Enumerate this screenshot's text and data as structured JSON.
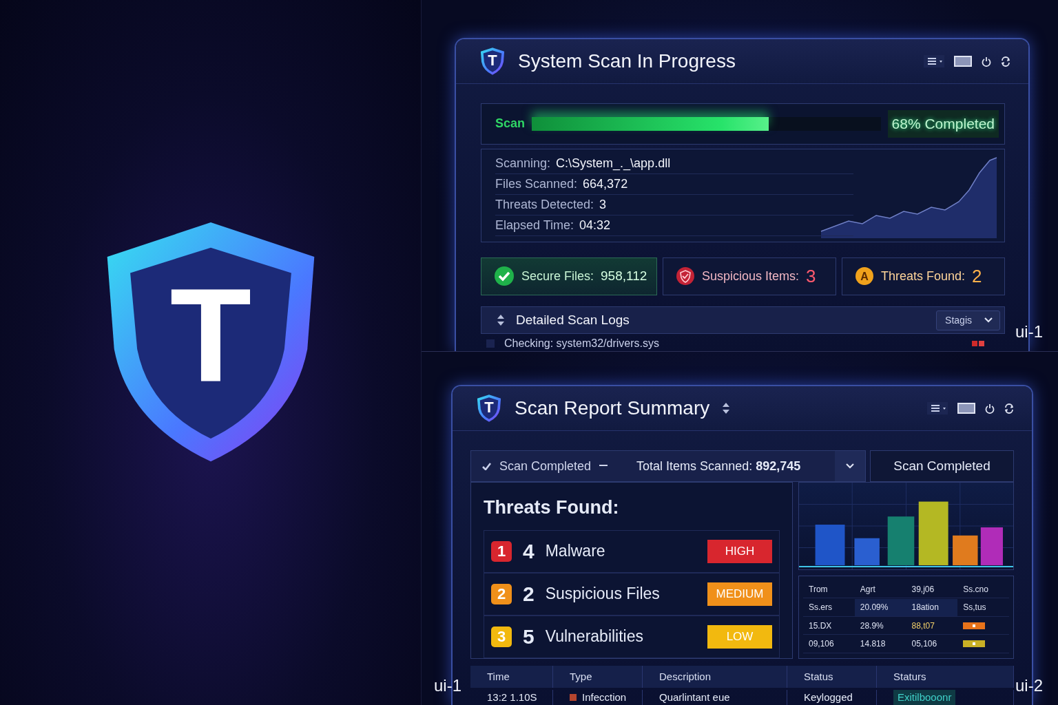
{
  "logo": {
    "letter": "T"
  },
  "panel_labels": [
    "ui-1",
    "ui-1",
    "ui-2"
  ],
  "scan_window": {
    "icon_letter": "T",
    "title": "System Scan In Progress",
    "progress": {
      "label": "Scan",
      "level": 0.68,
      "reading": "68% Completed"
    },
    "details": [
      {
        "label": "Scanning:",
        "value": "C:\\System_._\\app.dll"
      },
      {
        "label": "Files Scanned:",
        "value": "664,372"
      },
      {
        "label": "Threats Detected:",
        "value": "3"
      },
      {
        "label": "Elapsed Time:",
        "value": "04:32"
      }
    ],
    "stats": [
      {
        "kind": "secure",
        "label": "Secure Files:",
        "value": "958,112"
      },
      {
        "kind": "suspicious",
        "label": "Suspicious Items:",
        "value": "3"
      },
      {
        "kind": "threat",
        "label": "Threats Found:",
        "value": "2",
        "icon_letter": "A"
      }
    ],
    "logs": {
      "title": "Detailed Scan Logs",
      "filter": "Stagis",
      "rows": [
        {
          "text": "Checking: system32/drivers.sys"
        }
      ]
    }
  },
  "report_window": {
    "icon_letter": "T",
    "title": "Scan Report Summary",
    "summary": {
      "status": "Scan Completed",
      "total_label": "Total Items Scanned:",
      "total_value": "892,745"
    },
    "side_label": "Scan Completed",
    "threats_title": "Threats Found:",
    "threats": [
      {
        "rank": "1",
        "count": "4",
        "name": "Malware",
        "severity": "HIGH",
        "color": "#d8262e"
      },
      {
        "rank": "2",
        "count": "2",
        "name": "Suspicious Files",
        "severity": "MEDIUM",
        "color": "#f0901a"
      },
      {
        "rank": "3",
        "count": "5",
        "name": "Vulnerabilities",
        "severity": "LOW",
        "color": "#f2b90f"
      }
    ],
    "mini_table": {
      "rows": [
        {
          "cells": [
            "Trom",
            "Agrt",
            "39,j06",
            "Ss.cno"
          ]
        },
        {
          "cells": [
            "Ss.ers",
            "20.09%",
            "18ation",
            "Ss,tus"
          ]
        },
        {
          "cells": [
            "15.DX",
            "28.9%",
            "88,t07"
          ],
          "color": "#e8731a"
        },
        {
          "cells": [
            "09,106",
            "14.818",
            "05,106"
          ],
          "color": "#c9b025"
        }
      ]
    },
    "log_table": {
      "columns": [
        "Time",
        "Type",
        "Description",
        "Status",
        "Staturs"
      ],
      "rows": [
        {
          "cells": [
            "13:2 1.10S",
            "Infecction",
            "Quarlintant eue",
            "Keylogged",
            "Exitilbooonr"
          ],
          "color": "#b5452e"
        }
      ]
    }
  }
}
